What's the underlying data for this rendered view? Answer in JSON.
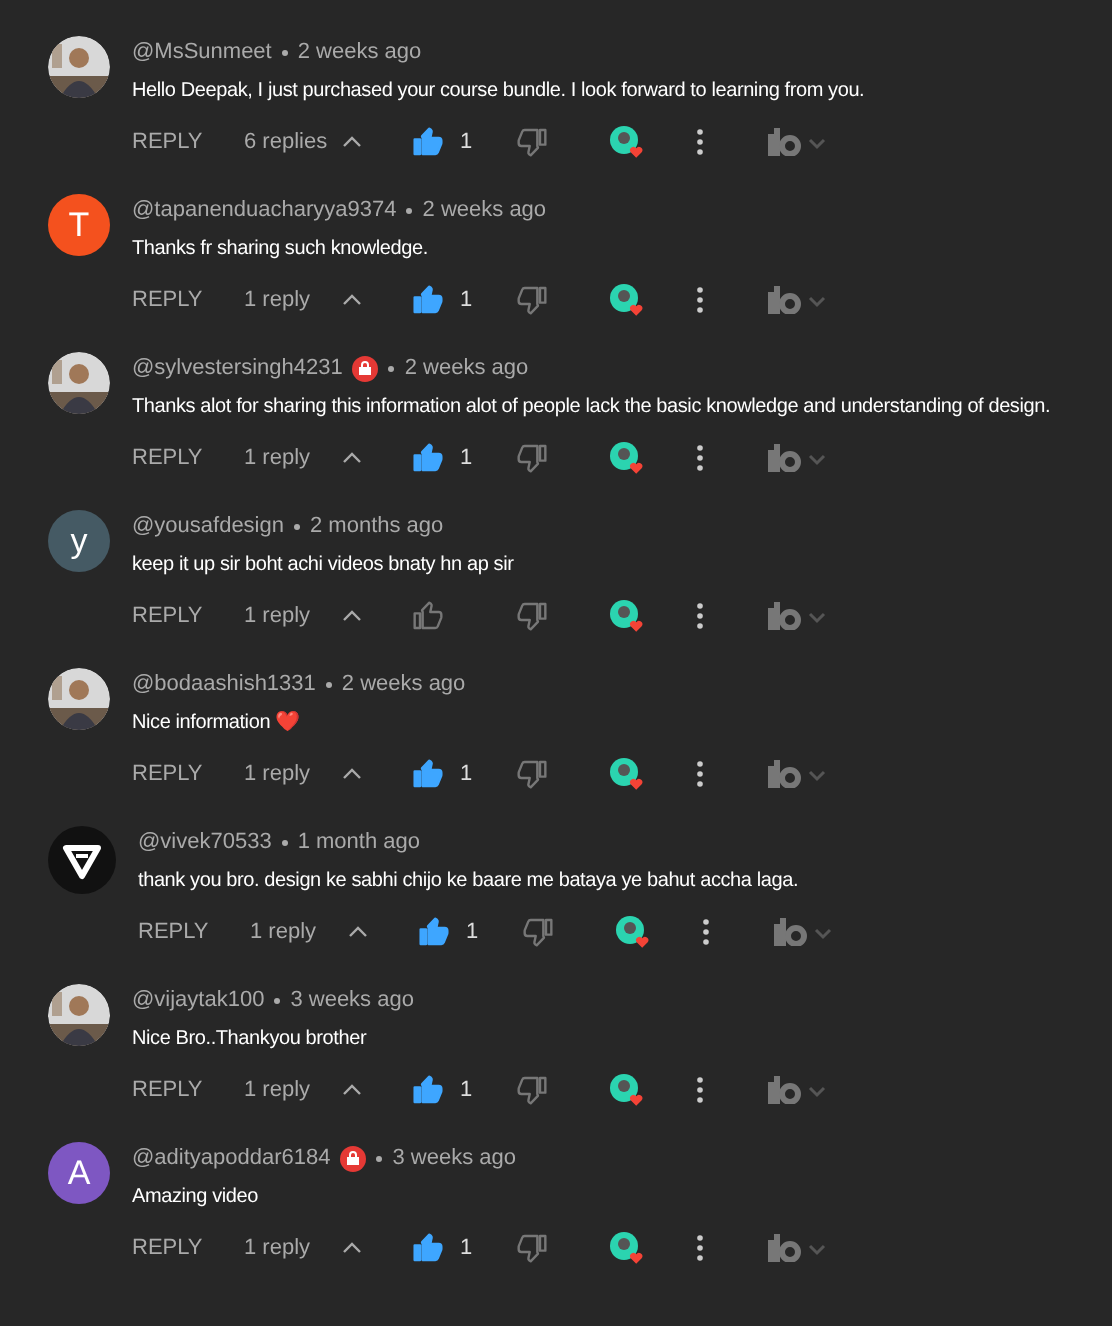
{
  "comments": [
    {
      "author": "@MsSunmeet",
      "member": false,
      "time": "2 weeks ago",
      "text": "Hello Deepak, I just purchased your course bundle. I look forward to learning from you.",
      "reply": "REPLY",
      "replies": "6 replies",
      "liked": true,
      "likes": "1"
    },
    {
      "avatar": {
        "kind": "letter",
        "letter": "T",
        "color": "#f4511e"
      },
      "author": "@tapanenduacharyya9374",
      "member": false,
      "time": "2 weeks ago",
      "text": "Thanks fr sharing such knowledge.",
      "reply": "REPLY",
      "replies": "1 reply",
      "liked": true,
      "likes": "1"
    },
    {
      "author": "@sylvestersingh4231",
      "member": true,
      "time": "2 weeks ago",
      "text": "Thanks alot for sharing this information alot of people lack the basic knowledge and understanding of design.",
      "reply": "REPLY",
      "replies": "1 reply",
      "liked": true,
      "likes": "1"
    },
    {
      "avatar": {
        "kind": "letter",
        "letter": "y",
        "color": "#455a64"
      },
      "author": "@yousafdesign",
      "member": false,
      "time": "2 months ago",
      "text": "keep it up sir boht achi videos bnaty hn ap sir",
      "reply": "REPLY",
      "replies": "1 reply",
      "liked": false
    },
    {
      "author": "@bodaashish1331",
      "member": false,
      "time": "2 weeks ago",
      "text": "Nice information ❤️",
      "reply": "REPLY",
      "replies": "1 reply",
      "liked": true,
      "likes": "1"
    },
    {
      "avatar": {
        "kind": "logo"
      },
      "author": "@vivek70533",
      "member": false,
      "time": "1 month ago",
      "text": "thank you bro. design ke sabhi chijo ke baare me bataya ye bahut accha laga.",
      "reply": "REPLY",
      "replies": "1 reply",
      "liked": true,
      "likes": "1"
    },
    {
      "author": "@vijaytak100",
      "member": false,
      "time": "3 weeks ago",
      "text": "Nice Bro..Thankyou brother",
      "reply": "REPLY",
      "replies": "1 reply",
      "liked": true,
      "likes": "1"
    },
    {
      "avatar": {
        "kind": "letter",
        "letter": "A",
        "color": "#7e57c2"
      },
      "author": "@adityapoddar6184",
      "member": true,
      "time": "3 weeks ago",
      "text": "Amazing video",
      "reply": "REPLY",
      "replies": "1 reply",
      "liked": true,
      "likes": "1"
    }
  ]
}
